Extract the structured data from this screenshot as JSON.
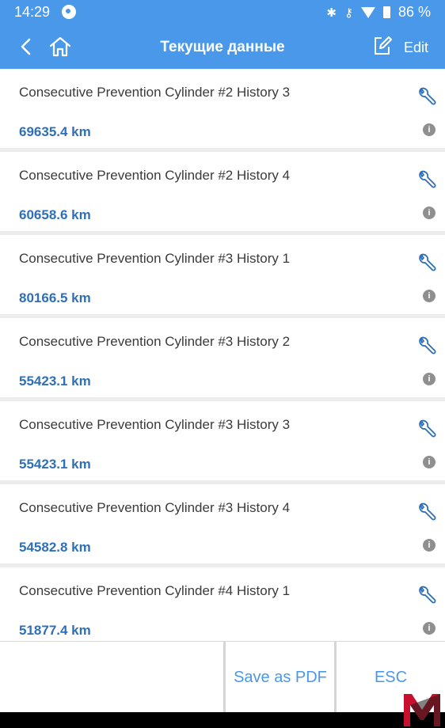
{
  "status_bar": {
    "time": "14:29",
    "battery": "86 %"
  },
  "header": {
    "title": "Текущие данные",
    "edit_label": "Edit"
  },
  "rows": [
    {
      "name": "Consecutive Prevention Cylinder #2 History 3",
      "value": "69635.4 km"
    },
    {
      "name": "Consecutive Prevention Cylinder #2 History 4",
      "value": "60658.6 km"
    },
    {
      "name": "Consecutive Prevention Cylinder #3 History 1",
      "value": "80166.5 km"
    },
    {
      "name": "Consecutive Prevention Cylinder #3 History 2",
      "value": "55423.1 km"
    },
    {
      "name": "Consecutive Prevention Cylinder #3 History 3",
      "value": "55423.1 km"
    },
    {
      "name": "Consecutive Prevention Cylinder #3 History 4",
      "value": "54582.8 km"
    },
    {
      "name": "Consecutive Prevention Cylinder #4 History 1",
      "value": "51877.4 km"
    }
  ],
  "info_glyph": "i",
  "footer": {
    "save_pdf_label": "Save as PDF",
    "esc_label": "ESC"
  },
  "colors": {
    "accent": "#4a98ea",
    "value_text": "#2f6fb8",
    "logo_red": "#c8102e"
  },
  "icons": {
    "back": "chevron-left-icon",
    "home": "home-icon",
    "edit": "edit-icon",
    "wrench": "wrench-icon",
    "info": "info-icon",
    "logo": "m-logo"
  }
}
